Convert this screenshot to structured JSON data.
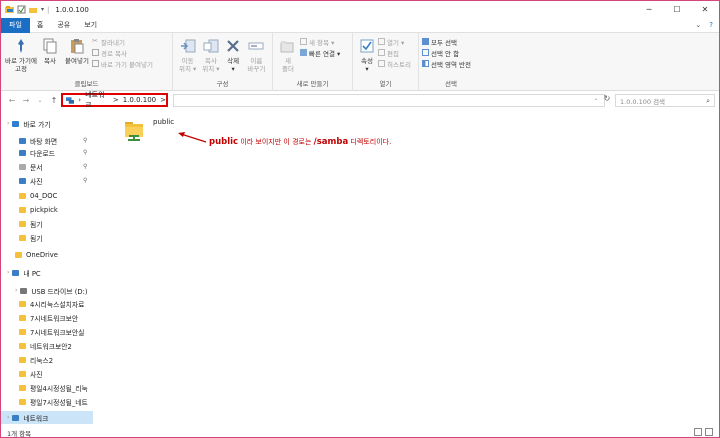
{
  "titlebar": {
    "title": "1.0.0.100",
    "minimize": "─",
    "maximize": "☐",
    "close": "✕"
  },
  "tabs": [
    "파일",
    "홈",
    "공유",
    "보기"
  ],
  "ribbon": {
    "clipboard": {
      "pin": "바로 가기에\n고정",
      "copy": "복사",
      "paste": "붙여넣기",
      "cut": "잘라내기",
      "copy_path": "경로 복사",
      "paste_shortcut": "바로 가기 붙여넣기",
      "label": "클립보드"
    },
    "organize": {
      "move": "이동\n위치 ▾",
      "copy_to": "복사\n위치 ▾",
      "delete": "삭제\n▾",
      "rename": "이름\n바꾸기",
      "label": "구성"
    },
    "new": {
      "new_folder": "새\n폴더",
      "new_item": "새 항목 ▾",
      "easy_access": "빠른 연결 ▾",
      "label": "새로 만들기"
    },
    "open": {
      "properties": "속성\n▾",
      "open": "열기 ▾",
      "edit": "편집",
      "history": "히스토리",
      "label": "열기"
    },
    "select": {
      "select_all": "모두 선택",
      "select_none": "선택 안 함",
      "invert": "선택 영역 반전",
      "label": "선택"
    }
  },
  "address": {
    "segments": [
      "네트워크",
      ">",
      "1.0.0.100",
      ">"
    ],
    "search_placeholder": "1.0.0.100 검색"
  },
  "nav": {
    "items": [
      {
        "label": "바로 가기",
        "level": 0,
        "icon": "star-icon"
      },
      {
        "label": "바탕 화면",
        "level": 1,
        "icon": "desktop-icon",
        "pinned": true
      },
      {
        "label": "다운로드",
        "level": 1,
        "icon": "download-icon",
        "pinned": true
      },
      {
        "label": "문서",
        "level": 1,
        "icon": "documents-icon",
        "pinned": true
      },
      {
        "label": "사진",
        "level": 1,
        "icon": "pictures-icon",
        "pinned": true
      },
      {
        "label": "04_DOC",
        "level": 1,
        "icon": "folder-icon"
      },
      {
        "label": "pickpick",
        "level": 1,
        "icon": "folder-icon"
      },
      {
        "label": "됨기",
        "level": 1,
        "icon": "folder-icon"
      },
      {
        "label": "됨기",
        "level": 1,
        "icon": "folder-icon"
      },
      {
        "label": "OneDrive",
        "level": 0,
        "icon": "onedrive-icon"
      },
      {
        "label": "내 PC",
        "level": 0,
        "icon": "pc-icon"
      },
      {
        "label": "USB 드라이브 (D:)",
        "level": 0,
        "icon": "usb-icon"
      },
      {
        "label": "4시리눅스설치자료",
        "level": 1,
        "icon": "folder-icon"
      },
      {
        "label": "7시네트워크보안",
        "level": 1,
        "icon": "folder-icon"
      },
      {
        "label": "7시네트워크보안실",
        "level": 1,
        "icon": "folder-icon"
      },
      {
        "label": "네트워크보안2",
        "level": 1,
        "icon": "folder-icon"
      },
      {
        "label": "리눅스2",
        "level": 1,
        "icon": "folder-icon"
      },
      {
        "label": "사진",
        "level": 1,
        "icon": "folder-icon"
      },
      {
        "label": "평일4시정성될_리눅",
        "level": 1,
        "icon": "folder-icon"
      },
      {
        "label": "평일7시정성될_네트",
        "level": 1,
        "icon": "folder-icon"
      },
      {
        "label": "네트워크",
        "level": 0,
        "icon": "network-icon",
        "selected": true
      }
    ]
  },
  "content": {
    "folder_label": "public",
    "annotation_strong": "public",
    "annotation_mid": " 이라 보이지만 이 경로는 ",
    "annotation_strong2": "/samba",
    "annotation_end": " 디렉토리이다."
  },
  "status": {
    "text": "1개 항목"
  },
  "colors": {
    "file_tab": "#1a6fc4",
    "annotation": "#c00000",
    "highlight_box": "#e00000",
    "selected": "#cce4f7",
    "folder": "#f3c13a"
  }
}
